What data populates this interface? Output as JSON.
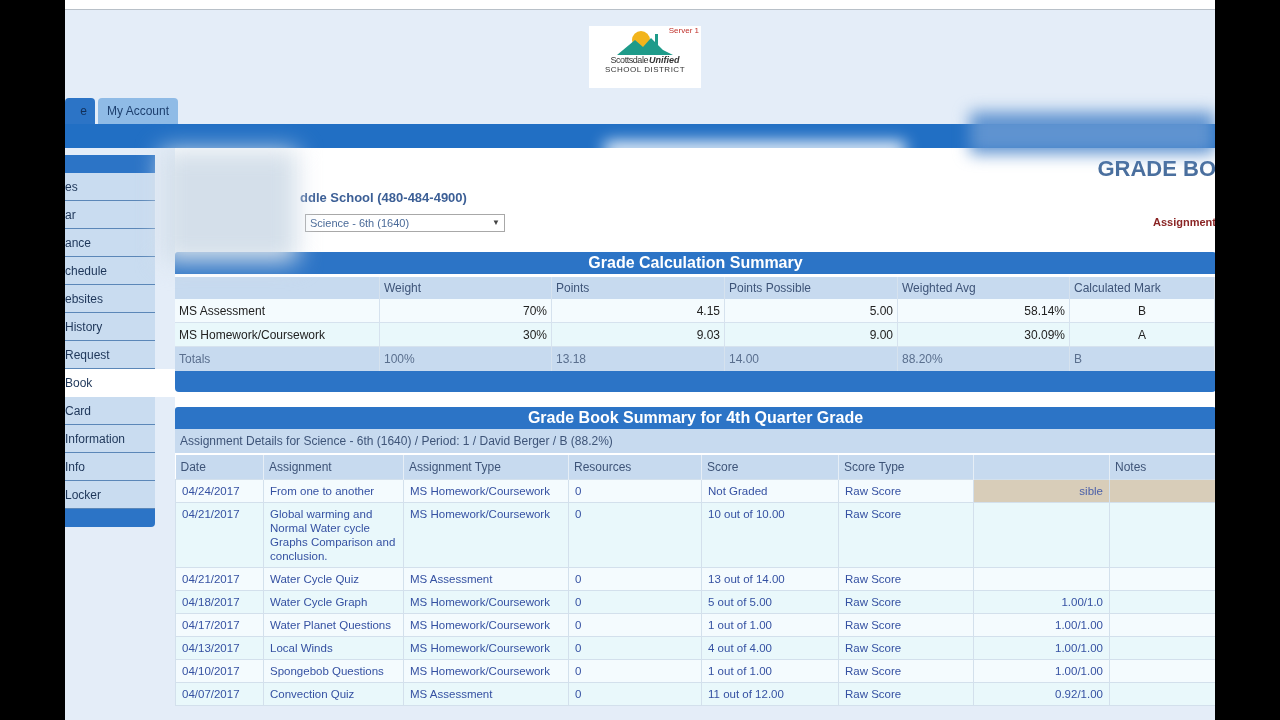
{
  "logo": {
    "badge": "Server 1",
    "name": "Scottsdale",
    "name_script": "Unified",
    "subtitle": "SCHOOL DISTRICT"
  },
  "tabs": [
    {
      "label": "e",
      "selected": true
    },
    {
      "label": "My Account",
      "selected": false
    }
  ],
  "sidebar": {
    "items": [
      {
        "label": "es",
        "selected": false
      },
      {
        "label": "ar",
        "selected": false
      },
      {
        "label": "ance",
        "selected": false
      },
      {
        "label": "chedule",
        "selected": false
      },
      {
        "label": "ebsites",
        "selected": false
      },
      {
        "label": "History",
        "selected": false
      },
      {
        "label": "Request",
        "selected": false
      },
      {
        "label": "Book",
        "selected": true
      },
      {
        "label": "Card",
        "selected": false
      },
      {
        "label": "Information",
        "selected": false
      },
      {
        "label": "Info",
        "selected": false
      },
      {
        "label": "Locker",
        "selected": false
      }
    ]
  },
  "page_title": "GRADE BO",
  "school": "ddle School (480-484-4900)",
  "class_select": {
    "value": "Science - 6th (1640)",
    "arrow": "▼"
  },
  "assignment_link": "Assignment",
  "calc_summary": {
    "title": "Grade Calculation Summary",
    "columns": [
      "",
      "Weight",
      "Points",
      "Points Possible",
      "Weighted Avg",
      "Calculated Mark"
    ],
    "rows": [
      [
        "MS Assessment",
        "70%",
        "4.15",
        "5.00",
        "58.14%",
        "B"
      ],
      [
        "MS Homework/Coursework",
        "30%",
        "9.03",
        "9.00",
        "30.09%",
        "A"
      ]
    ],
    "totals": [
      "Totals",
      "100%",
      "13.18",
      "14.00",
      "88.20%",
      "B"
    ]
  },
  "gradebook": {
    "title": "Grade Book Summary for 4th Quarter Grade",
    "details": "Assignment Details for Science - 6th (1640) / Period: 1 / David Berger / B (88.2%)",
    "columns": [
      "Date",
      "Assignment",
      "Assignment Type",
      "Resources",
      "Score",
      "Score Type",
      "",
      "Notes"
    ],
    "rows": [
      {
        "flagged": true,
        "cells": [
          "04/24/2017",
          "From one to another",
          "MS Homework/Coursework",
          "0",
          "Not Graded",
          "Raw Score",
          "sible",
          ""
        ]
      },
      {
        "flagged": false,
        "cells": [
          "04/21/2017",
          "Global warming and Normal Water cycle Graphs Comparison and conclusion.",
          "MS Homework/Coursework",
          "0",
          "10 out of 10.00",
          "Raw Score",
          "",
          ""
        ]
      },
      {
        "flagged": false,
        "cells": [
          "04/21/2017",
          "Water Cycle Quiz",
          "MS Assessment",
          "0",
          "13 out of 14.00",
          "Raw Score",
          "",
          ""
        ]
      },
      {
        "flagged": false,
        "cells": [
          "04/18/2017",
          "Water Cycle Graph",
          "MS Homework/Coursework",
          "0",
          "5 out of 5.00",
          "Raw Score",
          "1.00/1.0",
          ""
        ]
      },
      {
        "flagged": false,
        "cells": [
          "04/17/2017",
          "Water Planet Questions",
          "MS Homework/Coursework",
          "0",
          "1 out of 1.00",
          "Raw Score",
          "1.00/1.00",
          ""
        ]
      },
      {
        "flagged": false,
        "cells": [
          "04/13/2017",
          "Local Winds",
          "MS Homework/Coursework",
          "0",
          "4 out of 4.00",
          "Raw Score",
          "1.00/1.00",
          ""
        ]
      },
      {
        "flagged": false,
        "cells": [
          "04/10/2017",
          "Spongebob Questions",
          "MS Homework/Coursework",
          "0",
          "1 out of 1.00",
          "Raw Score",
          "1.00/1.00",
          ""
        ]
      },
      {
        "flagged": false,
        "cells": [
          "04/07/2017",
          "Convection Quiz",
          "MS Assessment",
          "0",
          "11 out of 12.00",
          "Raw Score",
          "0.92/1.00",
          ""
        ]
      }
    ]
  }
}
